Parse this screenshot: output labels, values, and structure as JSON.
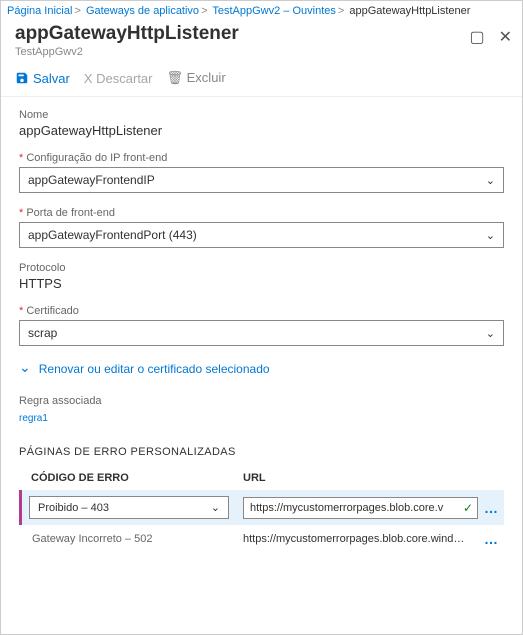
{
  "breadcrumb": {
    "home": "Página Inicial",
    "gateways": "Gateways de aplicativo",
    "app": "TestAppGwv2 – Ouvintes",
    "current": "appGatewayHttpListener"
  },
  "header": {
    "title": "appGatewayHttpListener",
    "subtitle": "TestAppGwv2"
  },
  "toolbar": {
    "save": "Salvar",
    "discard": "X  Descartar",
    "delete": "Excluir"
  },
  "fields": {
    "name_label": "Nome",
    "name_value": "appGatewayHttpListener",
    "frontend_ip_label": "Configuração do IP front-end",
    "frontend_ip_value": "appGatewayFrontendIP",
    "frontend_port_label": "Porta de front-end",
    "frontend_port_value": "appGatewayFrontendPort (443)",
    "protocol_label": "Protocolo",
    "protocol_value": "HTTPS",
    "cert_label": "Certificado",
    "cert_value": "scrap",
    "renew_label": "Renovar ou editar o certificado selecionado",
    "assoc_label": "Regra associada",
    "assoc_value": "regra1"
  },
  "errorpages": {
    "heading": "PÁGINAS DE ERRO PERSONALIZADAS",
    "col_code": "CÓDIGO DE ERRO",
    "col_url": "URL",
    "rows": [
      {
        "code_label": "Proibido –  403",
        "url": "https://mycustomerrorpages.blob.core.v"
      },
      {
        "code_label": "Gateway Incorreto – 502",
        "url": "https://mycustomerrorpages.blob.core.wind…"
      }
    ]
  }
}
